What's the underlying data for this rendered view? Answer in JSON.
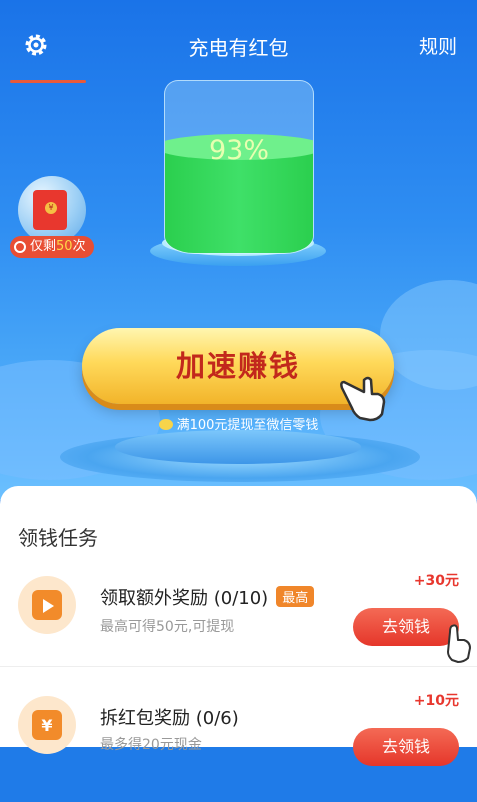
{
  "header": {
    "title": "充电有红包",
    "rules": "规则"
  },
  "battery": {
    "percent_label": "93%",
    "percent": 93
  },
  "float_envelope": {
    "coin": "¥",
    "prefix": "仅剩",
    "count": "50",
    "suffix": "次"
  },
  "main_button": {
    "label": "加速赚钱"
  },
  "hint": {
    "text": "满100元提现至微信零钱"
  },
  "tasks_panel": {
    "title": "领钱任务",
    "tasks": [
      {
        "name": "领取额外奖励 (0/10)",
        "badge": "最高",
        "sub": "最高可得50元,可提现",
        "reward": "+30元",
        "button": "去领钱",
        "icon": "video-icon"
      },
      {
        "name": "拆红包奖励 (0/6)",
        "badge": "",
        "sub": "最多得20元现金",
        "reward": "+10元",
        "button": "去领钱",
        "icon": "red-envelope-icon"
      }
    ]
  },
  "colors": {
    "accent": "#e8372e",
    "hero_blue": "#1a73e8",
    "button_gold": "#ffd95a",
    "liquid": "#3fe068"
  }
}
